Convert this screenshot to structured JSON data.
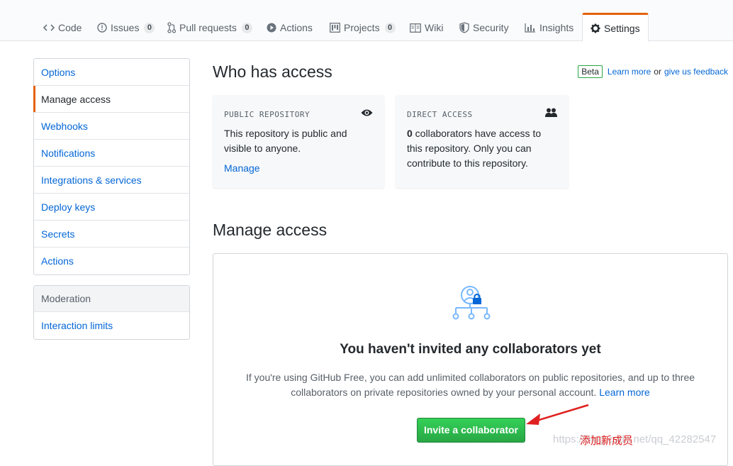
{
  "nav": {
    "tabs": [
      {
        "label": "Code",
        "icon": "code-icon"
      },
      {
        "label": "Issues",
        "count": "0",
        "icon": "issue-icon"
      },
      {
        "label": "Pull requests",
        "count": "0",
        "icon": "pull-request-icon"
      },
      {
        "label": "Actions",
        "icon": "play-icon"
      },
      {
        "label": "Projects",
        "count": "0",
        "icon": "project-icon"
      },
      {
        "label": "Wiki",
        "icon": "book-icon"
      },
      {
        "label": "Security",
        "icon": "shield-icon"
      },
      {
        "label": "Insights",
        "icon": "graph-icon"
      },
      {
        "label": "Settings",
        "icon": "gear-icon",
        "selected": true
      }
    ]
  },
  "sidebar": {
    "items": [
      {
        "label": "Options"
      },
      {
        "label": "Manage access",
        "active": true
      },
      {
        "label": "Webhooks"
      },
      {
        "label": "Notifications"
      },
      {
        "label": "Integrations & services"
      },
      {
        "label": "Deploy keys"
      },
      {
        "label": "Secrets"
      },
      {
        "label": "Actions"
      }
    ],
    "moderation": {
      "heading": "Moderation",
      "items": [
        {
          "label": "Interaction limits"
        }
      ]
    }
  },
  "main": {
    "title": "Who has access",
    "beta": {
      "badge": "Beta",
      "learn_more": "Learn more",
      "or": "or",
      "feedback": "give us feedback"
    },
    "public_card": {
      "label": "PUBLIC REPOSITORY",
      "text": "This repository is public and visible to anyone.",
      "link": "Manage",
      "icon": "eye-icon"
    },
    "direct_card": {
      "label": "DIRECT ACCESS",
      "count": "0",
      "text": " collaborators have access to this repository. Only you can contribute to this repository.",
      "icon": "people-icon"
    },
    "manage_title": "Manage access",
    "blankslate": {
      "title": "You haven't invited any collaborators yet",
      "desc": "If you're using GitHub Free, you can add unlimited collaborators on public repositories, and up to three collaborators on private repositories owned by your personal account. ",
      "learn_more": "Learn more",
      "button": "Invite a collaborator",
      "icon": "collaborator-lock-icon"
    }
  },
  "annotation": {
    "note": "添加新成员",
    "watermark": "https://blog.csdn.net/qq_42282547",
    "arrow_color": "#e02020"
  },
  "colors": {
    "link": "#0366d6",
    "accent_tab": "#e36209",
    "primary_button": "#28a745"
  }
}
